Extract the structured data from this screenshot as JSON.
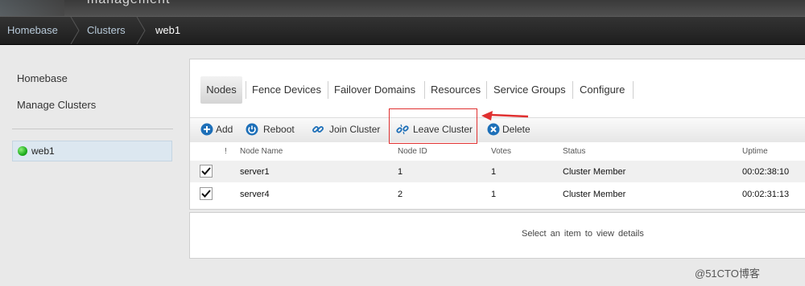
{
  "header": {
    "title": "management"
  },
  "breadcrumb": {
    "items": [
      "Homebase",
      "Clusters",
      "web1"
    ]
  },
  "sidebar": {
    "links": [
      "Homebase",
      "Manage Clusters"
    ],
    "clusters": [
      {
        "name": "web1",
        "status_color": "#22b322"
      }
    ]
  },
  "tabs": [
    "Nodes",
    "Fence Devices",
    "Failover Domains",
    "Resources",
    "Service Groups",
    "Configure"
  ],
  "toolbar": {
    "add": "Add",
    "reboot": "Reboot",
    "join": "Join Cluster",
    "leave": "Leave Cluster",
    "delete": "Delete"
  },
  "table": {
    "columns": [
      "!",
      "Node Name",
      "Node ID",
      "Votes",
      "Status",
      "Uptime"
    ],
    "rows": [
      {
        "name": "server1",
        "id": "1",
        "votes": "1",
        "status": "Cluster Member",
        "uptime": "00:02:38:10",
        "checked": true
      },
      {
        "name": "server4",
        "id": "2",
        "votes": "1",
        "status": "Cluster Member",
        "uptime": "00:02:31:13",
        "checked": true
      }
    ]
  },
  "details": {
    "message": "Select an item to view details"
  },
  "watermark": "@51CTO博客",
  "colors": {
    "annotation_red": "#e03030",
    "accent_blue": "#1d6fb8"
  }
}
